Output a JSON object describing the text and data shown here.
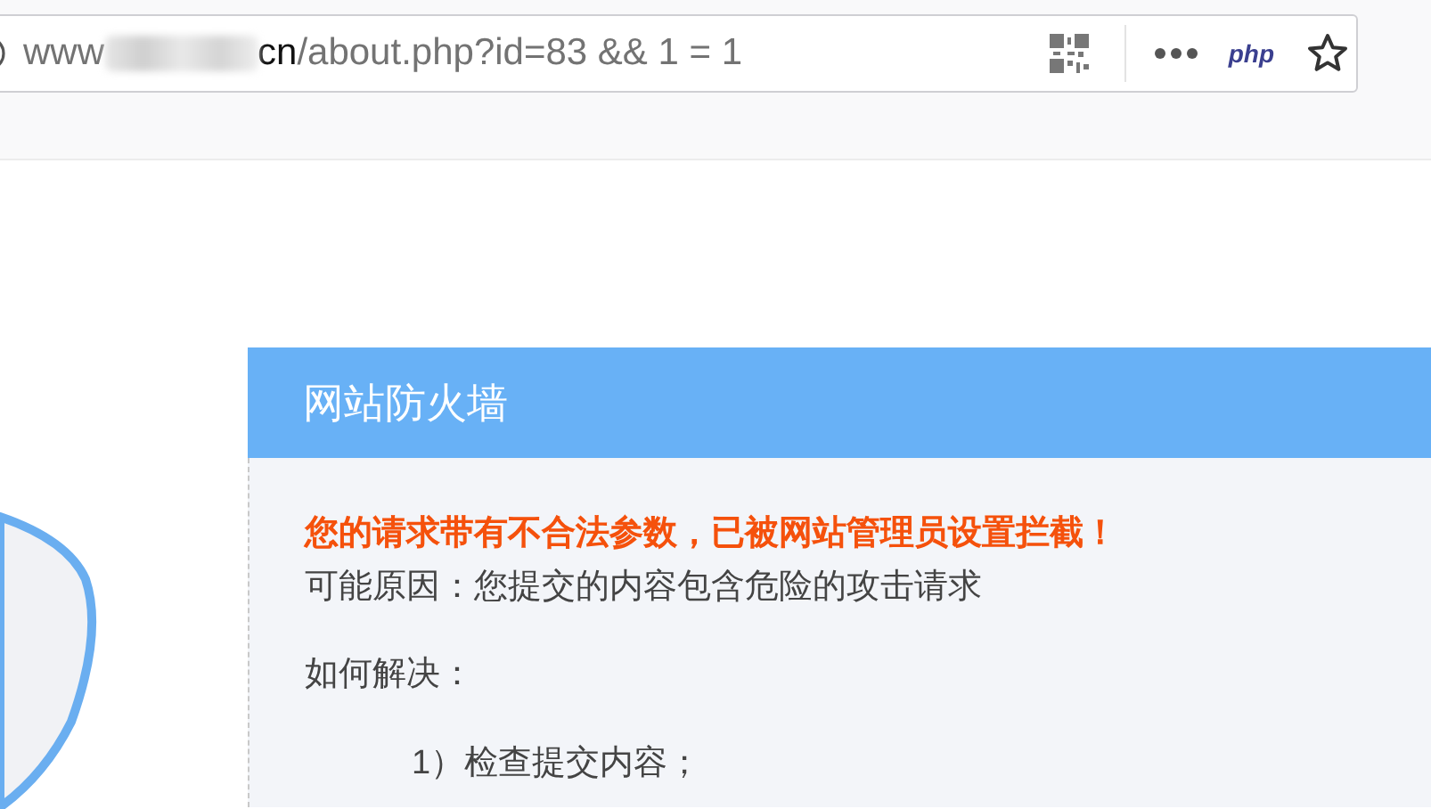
{
  "address_bar": {
    "url_start": "www",
    "url_host_end": "cn",
    "url_path": "/about.php?id=83 && 1 = 1",
    "php_badge": "php"
  },
  "firewall_panel": {
    "title": "网站防火墙",
    "warning": "您的请求带有不合法参数，已被网站管理员设置拦截！",
    "reason": "可能原因：您提交的内容包含危险的攻击请求",
    "solution_heading": "如何解决：",
    "steps": [
      "1）检查提交内容；"
    ]
  }
}
